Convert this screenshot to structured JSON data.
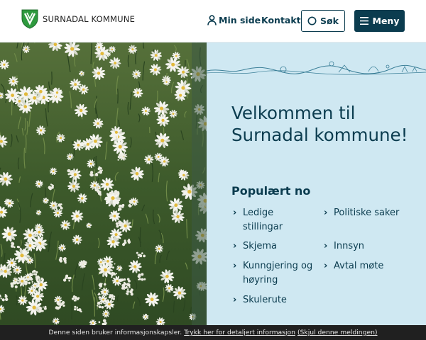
{
  "header": {
    "site_name": "SURNADAL KOMMUNE",
    "min_side": "Min side",
    "kontakt": "Kontakt",
    "sok": "Søk",
    "meny": "Meny"
  },
  "hero": {
    "title": "Velkommen til Surnadal kommune!",
    "popular_heading": "Populært no",
    "links": [
      "Ledige stillingar",
      "Politiske saker",
      "Skjema",
      "Innsyn",
      "Kunngjering og høyring",
      "Avtal møte",
      "Skulerute"
    ]
  },
  "cookie": {
    "text": "Denne siden bruker informasjonskapsler.",
    "details_link": "Trykk her for detaljert informasjon",
    "hide_link": "(Skjul denne meldingen)"
  },
  "colors": {
    "primary": "#0b3c4f",
    "panel": "#cfe8f2",
    "cookie_bar": "#202020"
  }
}
